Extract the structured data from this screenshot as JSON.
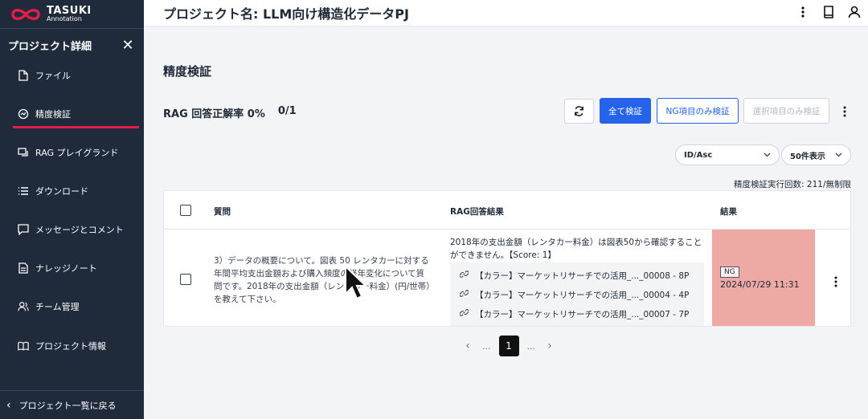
{
  "logo": {
    "line1": "TASUKI",
    "line2": "Annotation"
  },
  "header": {
    "title": "プロジェクト名: LLM向け構造化データPJ"
  },
  "sidebar": {
    "title": "プロジェクト詳細",
    "items": [
      {
        "label": "ファイル",
        "icon": "file-icon"
      },
      {
        "label": "精度検証",
        "icon": "accuracy-icon",
        "active": true
      },
      {
        "label": "RAG プレイグランド",
        "icon": "chat-icon"
      },
      {
        "label": "ダウンロード",
        "icon": "list-icon"
      },
      {
        "label": "メッセージとコメント",
        "icon": "message-icon"
      },
      {
        "label": "ナレッジノート",
        "icon": "note-icon"
      },
      {
        "label": "チーム管理",
        "icon": "team-icon"
      },
      {
        "label": "プロジェクト情報",
        "icon": "book-icon"
      }
    ],
    "back_label": "プロジェクト一覧に戻る"
  },
  "main": {
    "page_title": "精度検証",
    "accuracy_label": "RAG 回答正解率 0%",
    "accuracy_count": "0/1",
    "buttons": {
      "verify_all": "全て検証",
      "verify_ng": "NG項目のみ検証",
      "verify_selected": "選択項目のみ検証"
    },
    "sort_select": "ID/Asc",
    "count_select": "50件表示",
    "run_count": "精度検証実行回数: 211/無制限",
    "table": {
      "headers": {
        "question": "質問",
        "answer": "RAG回答結果",
        "result": "結果"
      },
      "rows": [
        {
          "question": "3）データの概要について。図表 50 レンタカーに対する年間平均支出金額および購入頻度の経年変化について質問です。2018年の支出金額（レンタカー料金）(円/世帯）を教えて下さい。",
          "answer": "2018年の支出金額（レンタカー料金）は図表50から確認することができません。【Score: 1】",
          "refs": [
            "【カラー】マーケットリサーチでの活用_..._00008 - 8P",
            "【カラー】マーケットリサーチでの活用_..._00004 - 4P",
            "【カラー】マーケットリサーチでの活用_..._00007 - 7P"
          ],
          "result_badge": "NG",
          "result_date": "2024/07/29 11:31",
          "result_color": "#efa9a5"
        }
      ]
    },
    "pagination": {
      "current": "1",
      "ellipsis": "..."
    }
  },
  "colors": {
    "sidebar_bg": "#1f2a3a",
    "accent": "#e11d48",
    "primary": "#2563eb"
  }
}
